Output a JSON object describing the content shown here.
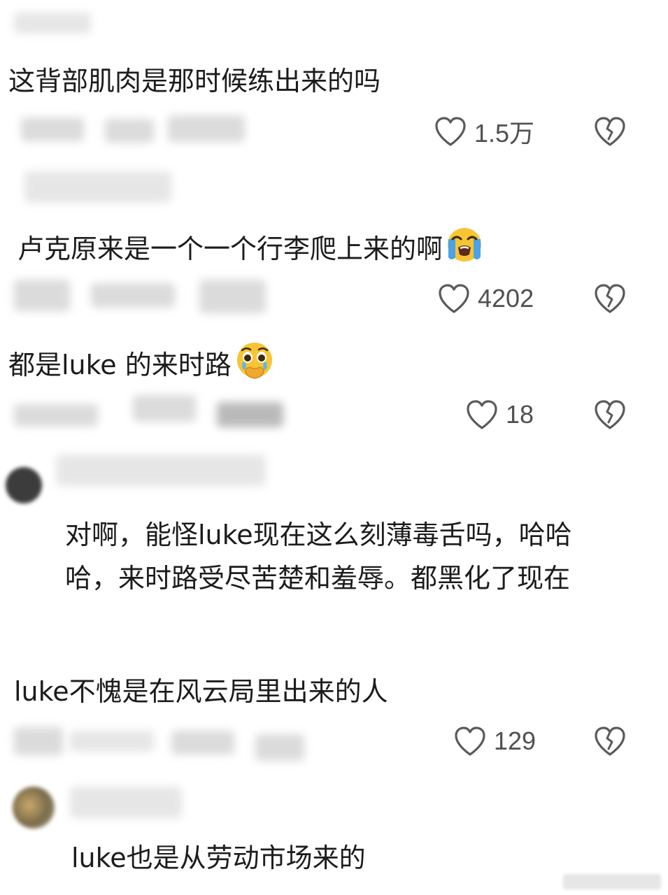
{
  "comments": [
    {
      "text": "这背部肌肉是那时候练出来的吗",
      "likes": "1.5万"
    },
    {
      "text": "卢克原来是一个一个行李爬上来的啊",
      "likes": "4202",
      "emoji": "loudly-crying-face"
    },
    {
      "text": "都是luke 的来时路",
      "likes": "18",
      "emoji": "face-holding-back-tears"
    },
    {
      "text": "对啊，能怪luke现在这么刻薄毒舌吗，哈哈哈，来时路受尽苦楚和羞辱。都黑化了现在"
    },
    {
      "text": "luke不愧是在风云局里出来的人",
      "likes": "129"
    },
    {
      "text": "luke也是从劳动市场来的"
    }
  ],
  "icons": {
    "like": "heart-outline-icon",
    "dislike": "broken-heart-icon"
  },
  "colors": {
    "text": "#1c1c1c",
    "count": "#505050",
    "icon": "#5a5a5a",
    "background": "#ffffff"
  }
}
